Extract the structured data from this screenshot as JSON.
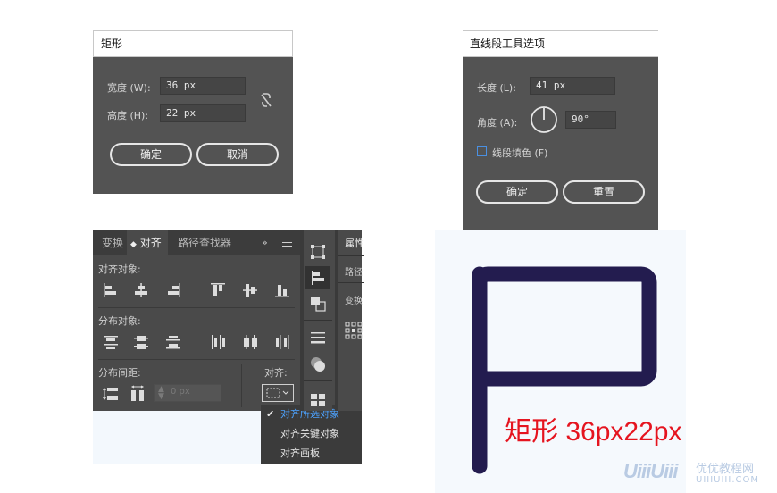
{
  "rect_dialog": {
    "title": "矩形",
    "width_label": "宽度 (W):",
    "width_value": "36 px",
    "height_label": "高度 (H):",
    "height_value": "22 px",
    "ok": "确定",
    "cancel": "取消"
  },
  "line_dialog": {
    "title": "直线段工具选项",
    "length_label": "长度 (L):",
    "length_value": "41 px",
    "angle_label": "角度 (A):",
    "angle_value": "90°",
    "fill_label": "线段填色 (F)",
    "ok": "确定",
    "reset": "重置"
  },
  "align_panel": {
    "tabs": [
      "变换",
      "对齐",
      "路径查找器"
    ],
    "align_objects_label": "对齐对象:",
    "distribute_objects_label": "分布对象:",
    "distribute_spacing_label": "分布间距:",
    "align_to_label": "对齐:",
    "spacing_value": "0 px",
    "menu": [
      "对齐所选对象",
      "对齐关键对象",
      "对齐画板"
    ]
  },
  "side_panel": {
    "title": "属性",
    "item1": "路径",
    "item2": "变换"
  },
  "illustration": {
    "caption": "矩形 36px22px",
    "stroke_color": "#231c4f",
    "caption_color": "#e5141f"
  },
  "watermark": {
    "logo": "UiiiUiii",
    "text_cn": "优优教程网",
    "text_url": "UIIIUIII.COM"
  }
}
